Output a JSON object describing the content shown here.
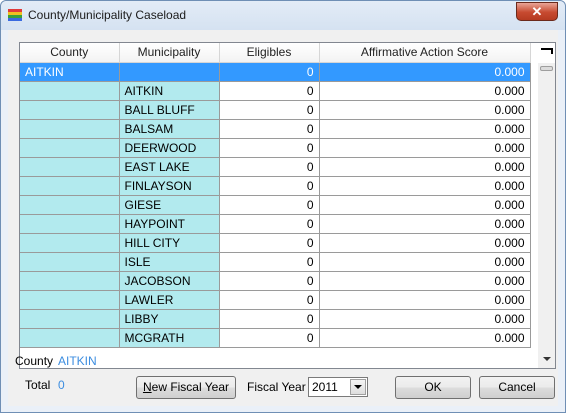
{
  "window": {
    "title": "County/Municipality Caseload",
    "close_glyph": "✕"
  },
  "grid": {
    "columns": [
      "County",
      "Municipality",
      "Eligibles",
      "Affirmative Action Score"
    ],
    "rows": [
      {
        "county": "AITKIN",
        "municipality": "",
        "eligibles": "0",
        "score": "0.000",
        "selected": true
      },
      {
        "county": "",
        "municipality": "AITKIN",
        "eligibles": "0",
        "score": "0.000"
      },
      {
        "county": "",
        "municipality": "BALL BLUFF",
        "eligibles": "0",
        "score": "0.000"
      },
      {
        "county": "",
        "municipality": "BALSAM",
        "eligibles": "0",
        "score": "0.000"
      },
      {
        "county": "",
        "municipality": "DEERWOOD",
        "eligibles": "0",
        "score": "0.000"
      },
      {
        "county": "",
        "municipality": "EAST LAKE",
        "eligibles": "0",
        "score": "0.000"
      },
      {
        "county": "",
        "municipality": "FINLAYSON",
        "eligibles": "0",
        "score": "0.000"
      },
      {
        "county": "",
        "municipality": "GIESE",
        "eligibles": "0",
        "score": "0.000"
      },
      {
        "county": "",
        "municipality": "HAYPOINT",
        "eligibles": "0",
        "score": "0.000"
      },
      {
        "county": "",
        "municipality": "HILL CITY",
        "eligibles": "0",
        "score": "0.000"
      },
      {
        "county": "",
        "municipality": "ISLE",
        "eligibles": "0",
        "score": "0.000"
      },
      {
        "county": "",
        "municipality": "JACOBSON",
        "eligibles": "0",
        "score": "0.000"
      },
      {
        "county": "",
        "municipality": "LAWLER",
        "eligibles": "0",
        "score": "0.000"
      },
      {
        "county": "",
        "municipality": "LIBBY",
        "eligibles": "0",
        "score": "0.000"
      },
      {
        "county": "",
        "municipality": "MCGRATH",
        "eligibles": "0",
        "score": "0.000"
      }
    ]
  },
  "footer": {
    "county_label": "County",
    "county_value": "AITKIN",
    "total_label": "Total",
    "total_value": "0",
    "new_fiscal_year_mnemonic": "N",
    "new_fiscal_year_rest": "ew Fiscal Year",
    "fiscal_year_label": "Fiscal Year",
    "fiscal_year_value": "2011",
    "ok_label": "OK",
    "cancel_label": "Cancel"
  },
  "colors": {
    "cell_cyan": "#b2eaee",
    "selection": "#3399ff",
    "value_blue": "#3c8de0"
  },
  "icons": [
    "app-icon",
    "close-icon",
    "scroll-down-arrow-icon",
    "dropdown-arrow-icon"
  ]
}
